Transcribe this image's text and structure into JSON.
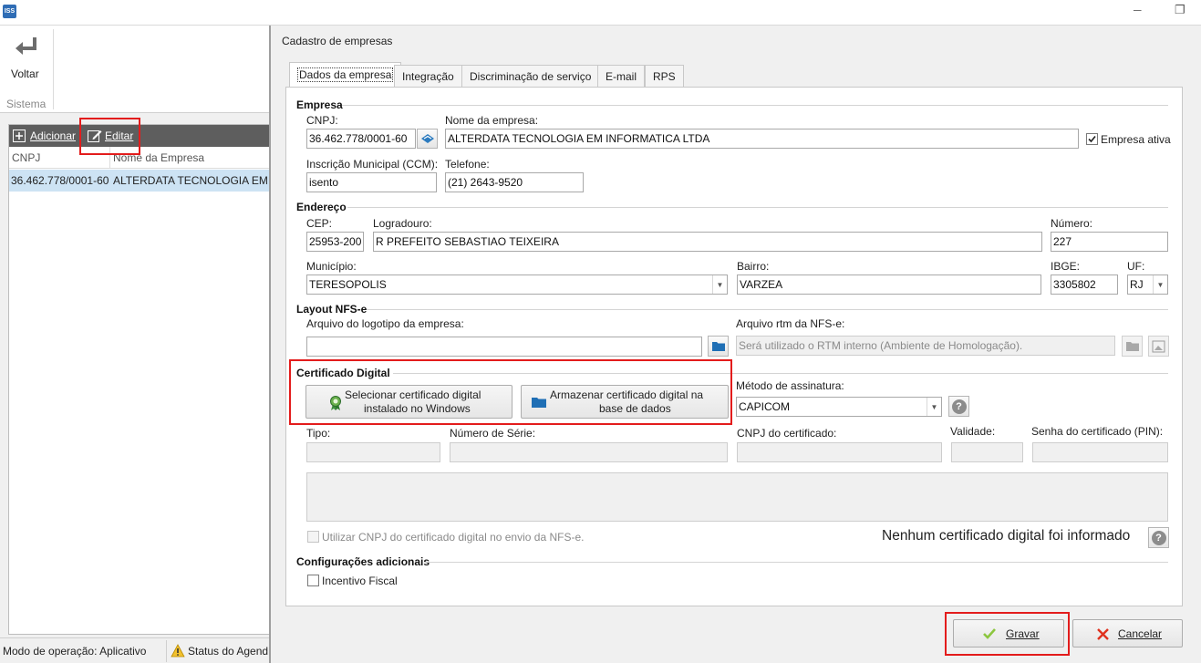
{
  "titlebar": {
    "app_icon": "iss-app-icon",
    "minimize": "─",
    "restore": "❐"
  },
  "ribbon": {
    "back_label": "Voltar",
    "group_label": "Sistema"
  },
  "left_toolbar": {
    "add_label": "Adicionar",
    "edit_label": "Editar"
  },
  "companies_table": {
    "columns": [
      "CNPJ",
      "Nome da Empresa"
    ],
    "rows": [
      {
        "cnpj": "36.462.778/0001-60",
        "name": "ALTERDATA TECNOLOGIA EM INFORMATICA LTDA"
      }
    ]
  },
  "status_bar": {
    "mode": "Modo de operação: Aplicativo",
    "agent": "Status do Agend"
  },
  "panel_title": "Cadastro de empresas",
  "tabs": [
    "Dados da empresa",
    "Integração",
    "Discriminação de serviço",
    "E-mail",
    "RPS"
  ],
  "empresa": {
    "section": "Empresa",
    "cnpj_label": "CNPJ:",
    "cnpj": "36.462.778/0001-60",
    "name_label": "Nome da empresa:",
    "name": "ALTERDATA TECNOLOGIA EM INFORMATICA LTDA",
    "active_label": "Empresa ativa",
    "ccm_label": "Inscrição Municipal (CCM):",
    "ccm": "isento",
    "phone_label": "Telefone:",
    "phone": "(21) 2643-9520"
  },
  "endereco": {
    "section": "Endereço",
    "cep_label": "CEP:",
    "cep": "25953-200",
    "street_label": "Logradouro:",
    "street": "R PREFEITO SEBASTIAO TEIXEIRA",
    "number_label": "Número:",
    "number": "227",
    "city_label": "Município:",
    "city": "TERESOPOLIS",
    "district_label": "Bairro:",
    "district": "VARZEA",
    "ibge_label": "IBGE:",
    "ibge": "3305802",
    "uf_label": "UF:",
    "uf": "RJ"
  },
  "layout": {
    "section": "Layout NFS-e",
    "logo_label": "Arquivo do logotipo da empresa:",
    "logo_value": "",
    "rtm_label": "Arquivo rtm da NFS-e:",
    "rtm_placeholder": "Será utilizado o RTM interno (Ambiente de Homologação)."
  },
  "certificado": {
    "section": "Certificado Digital",
    "select_btn_line1": "Selecionar certificado digital",
    "select_btn_line2": "instalado no Windows",
    "store_btn_line1": "Armazenar certificado digital na",
    "store_btn_line2": "base de dados",
    "method_label": "Método de assinatura:",
    "method": "CAPICOM",
    "type_label": "Tipo:",
    "serial_label": "Número de Série:",
    "cnpj_label": "CNPJ do certificado:",
    "validity_label": "Validade:",
    "pin_label": "Senha do certificado (PIN):",
    "use_cnpj_label": "Utilizar CNPJ do certificado digital no envio da NFS-e.",
    "status_msg": "Nenhum certificado digital foi informado",
    "help": "?"
  },
  "config": {
    "section": "Configurações adicionais",
    "incentive_label": "Incentivo Fiscal"
  },
  "actions": {
    "save_label": "Gravar",
    "cancel_label": "Cancelar"
  },
  "colors": {
    "highlight": "#e31c1c",
    "row_selected": "#cde3f4",
    "toolbar_dark": "#5e5e5e",
    "folder": "#1f6fb5"
  }
}
